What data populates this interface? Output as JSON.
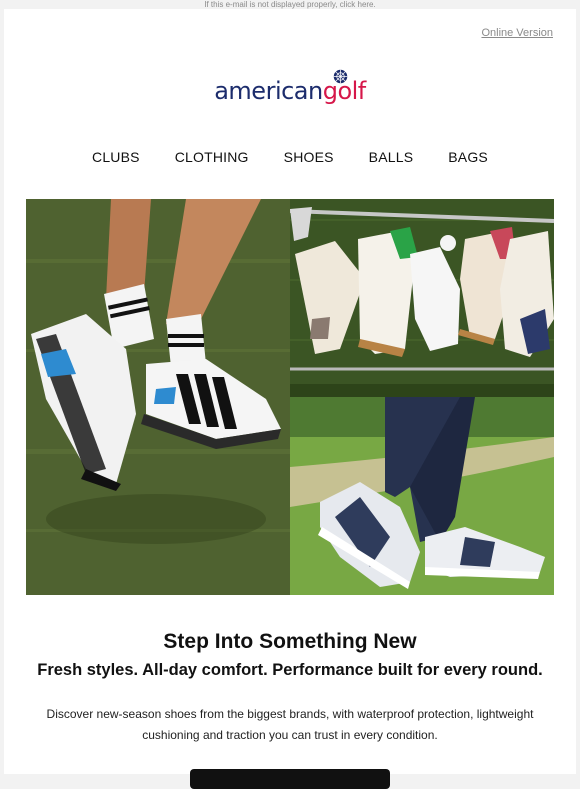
{
  "preheader": {
    "text": "If this e-mail is not displayed properly, click here."
  },
  "header": {
    "online_version": "Online Version"
  },
  "logo": {
    "part1": "american",
    "part2": "golf",
    "icon": "golf-ball-icon"
  },
  "nav": {
    "items": [
      {
        "label": "CLUBS"
      },
      {
        "label": "CLOTHING"
      },
      {
        "label": "SHOES"
      },
      {
        "label": "BALLS"
      },
      {
        "label": "BAGS"
      }
    ]
  },
  "hero": {
    "images": [
      "golfer-shoes-photo",
      "shoes-lineup-photo",
      "new-balance-shoes-photo"
    ]
  },
  "content": {
    "heading": "Step Into Something New",
    "subheading": "Fresh styles. All-day comfort. Performance built for every round.",
    "body": "Discover new-season shoes from the biggest brands, with waterproof protection, lightweight cushioning and traction you can trust in every condition."
  },
  "colors": {
    "brand_navy": "#1c2c6c",
    "brand_red": "#d6174a",
    "cta": "#111111"
  }
}
